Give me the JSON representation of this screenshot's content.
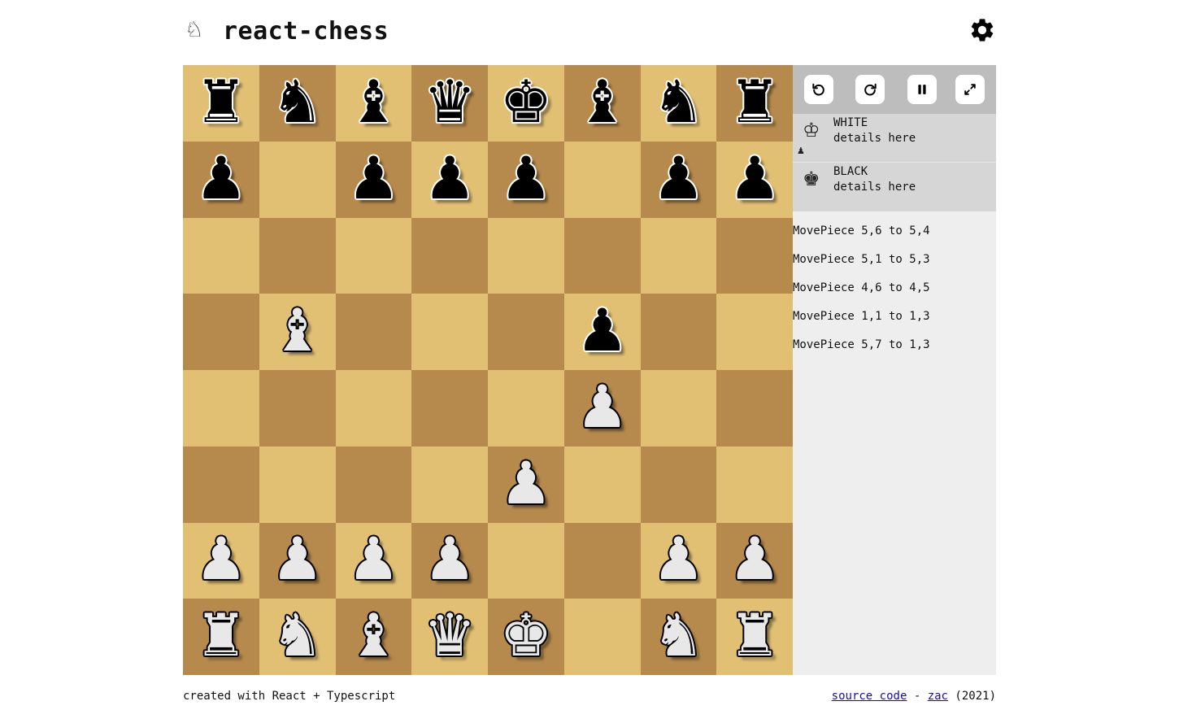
{
  "header": {
    "logo_glyph": "♘",
    "title": "react-chess",
    "settings_icon": "gear-icon"
  },
  "colors": {
    "light_square": "#e2c073",
    "dark_square": "#b68a4c",
    "panel_bg": "#eeeeee",
    "controls_bg": "#bdbdbd",
    "player_bg": "#d6d6d6"
  },
  "board": [
    [
      "br",
      "bn",
      "bb",
      "bq",
      "bk",
      "bb",
      "bn",
      "br"
    ],
    [
      "bp",
      "",
      "bp",
      "bp",
      "bp",
      "",
      "bp",
      "bp"
    ],
    [
      "",
      "",
      "",
      "",
      "",
      "",
      "",
      ""
    ],
    [
      "",
      "wb",
      "",
      "",
      "",
      "bp",
      "",
      ""
    ],
    [
      "",
      "",
      "",
      "",
      "",
      "wp",
      "",
      ""
    ],
    [
      "",
      "",
      "",
      "",
      "wp",
      "",
      "",
      ""
    ],
    [
      "wp",
      "wp",
      "wp",
      "wp",
      "",
      "",
      "wp",
      "wp"
    ],
    [
      "wr",
      "wn",
      "wb",
      "wq",
      "wk",
      "",
      "wn",
      "wr"
    ]
  ],
  "piece_glyphs": {
    "k": "♚",
    "q": "♛",
    "r": "♜",
    "b": "♝",
    "n": "♞",
    "p": "♟"
  },
  "controls": [
    {
      "name": "undo-button",
      "icon": "undo-icon"
    },
    {
      "name": "redo-button",
      "icon": "redo-icon"
    },
    {
      "name": "pause-button",
      "icon": "pause-icon"
    },
    {
      "name": "fullscreen-button",
      "icon": "expand-icon"
    }
  ],
  "players": {
    "white": {
      "king_glyph": "♔",
      "name": "WHITE",
      "details": "details here",
      "captured": "♟"
    },
    "black": {
      "king_glyph": "♚",
      "name": "BLACK",
      "details": "details here"
    }
  },
  "moves": [
    "MovePiece 5,6 to 5,4",
    "MovePiece 5,1 to 5,3",
    "MovePiece 4,6 to 4,5",
    "MovePiece 1,1 to 1,3",
    "MovePiece 5,7 to 1,3"
  ],
  "footer": {
    "credit": "created with React + Typescript",
    "source_link": "source code",
    "separator": "-",
    "author_link": "zac",
    "year": "(2021)"
  }
}
